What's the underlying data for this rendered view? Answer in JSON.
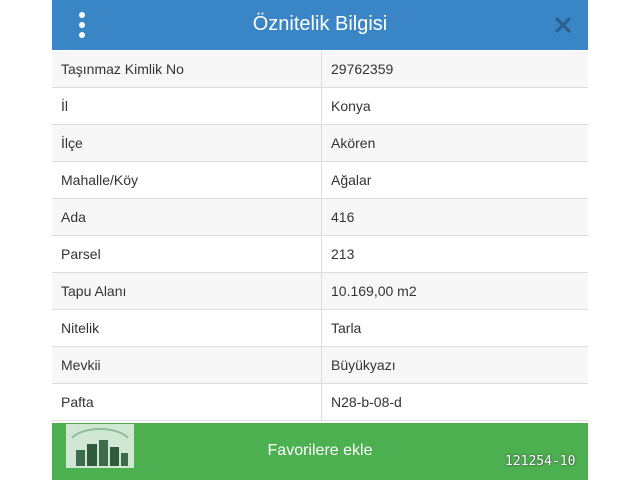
{
  "header": {
    "title": "Öznitelik Bilgisi",
    "menu_icon": "more-vertical-icon",
    "close_icon": "close-icon"
  },
  "attributes": [
    {
      "label": "Taşınmaz Kimlik No",
      "value": "29762359"
    },
    {
      "label": "İl",
      "value": "Konya"
    },
    {
      "label": "İlçe",
      "value": "Akören"
    },
    {
      "label": "Mahalle/Köy",
      "value": "Ağalar"
    },
    {
      "label": "Ada",
      "value": "416"
    },
    {
      "label": "Parsel",
      "value": "213"
    },
    {
      "label": "Tapu Alanı",
      "value": "10.169,00 m2"
    },
    {
      "label": "Nitelik",
      "value": "Tarla"
    },
    {
      "label": "Mevkii",
      "value": "Büyükyazı"
    },
    {
      "label": "Pafta",
      "value": "N28-b-08-d"
    }
  ],
  "footer": {
    "favorite_label": "Favorilere ekle"
  },
  "watermark": {
    "icon": "buildings-logo-icon"
  },
  "reference_code": "121254-10",
  "colors": {
    "header": "#3a85c6",
    "button": "#4caf50",
    "row_alt": "#f7f7f7"
  }
}
